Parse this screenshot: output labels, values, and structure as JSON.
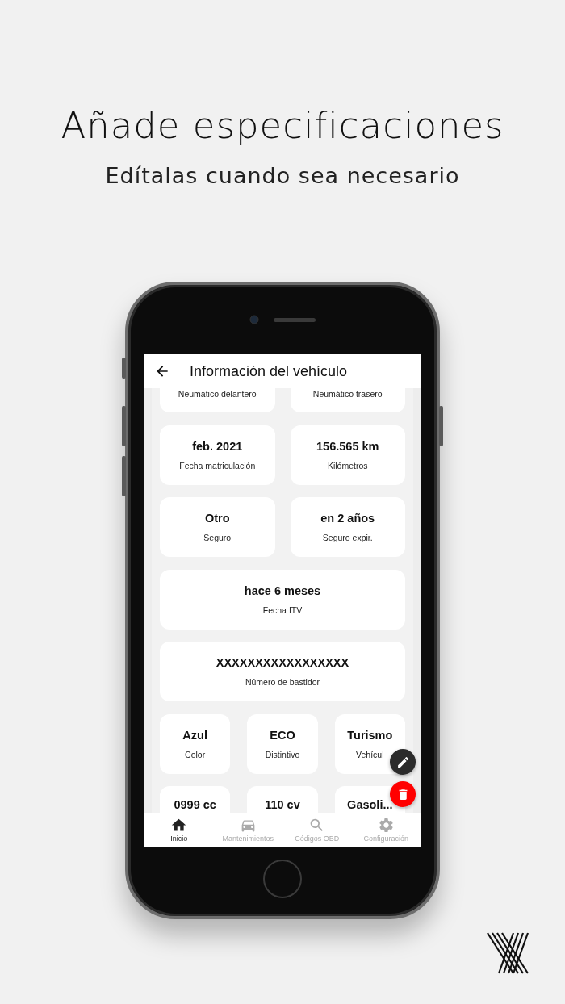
{
  "headline": "Añade especificaciones",
  "subheadline": "Edítalas cuando sea necesario",
  "app_bar": {
    "title": "Información del vehículo"
  },
  "rows": [
    {
      "cards": [
        {
          "label": "Neumático delantero"
        },
        {
          "label": "Neumático trasero"
        }
      ]
    },
    {
      "cards": [
        {
          "value": "feb. 2021",
          "label": "Fecha matriculación"
        },
        {
          "value": "156.565 km",
          "label": "Kilómetros"
        }
      ]
    },
    {
      "cards": [
        {
          "value": "Otro",
          "label": "Seguro"
        },
        {
          "value": "en 2 años",
          "label": "Seguro expir."
        }
      ]
    },
    {
      "cards": [
        {
          "value": "hace 6 meses",
          "label": "Fecha ITV"
        }
      ]
    },
    {
      "cards": [
        {
          "value": "XXXXXXXXXXXXXXXXX",
          "label": "Número de bastidor"
        }
      ]
    },
    {
      "cards": [
        {
          "value": "Azul",
          "label": "Color"
        },
        {
          "value": "ECO",
          "label": "Distintivo"
        },
        {
          "value": "Turismo",
          "label": "Vehícul"
        }
      ]
    },
    {
      "cards": [
        {
          "value": "0999 cc"
        },
        {
          "value": "110 cv"
        },
        {
          "value": "Gasoli..."
        }
      ]
    }
  ],
  "bottom_nav": [
    {
      "kind": "home",
      "label": "Inicio",
      "selected": true
    },
    {
      "kind": "car",
      "label": "Mantenimientos",
      "selected": false
    },
    {
      "kind": "search",
      "label": "Códigos OBD",
      "selected": false
    },
    {
      "kind": "settings",
      "label": "Configuración",
      "selected": false
    }
  ]
}
